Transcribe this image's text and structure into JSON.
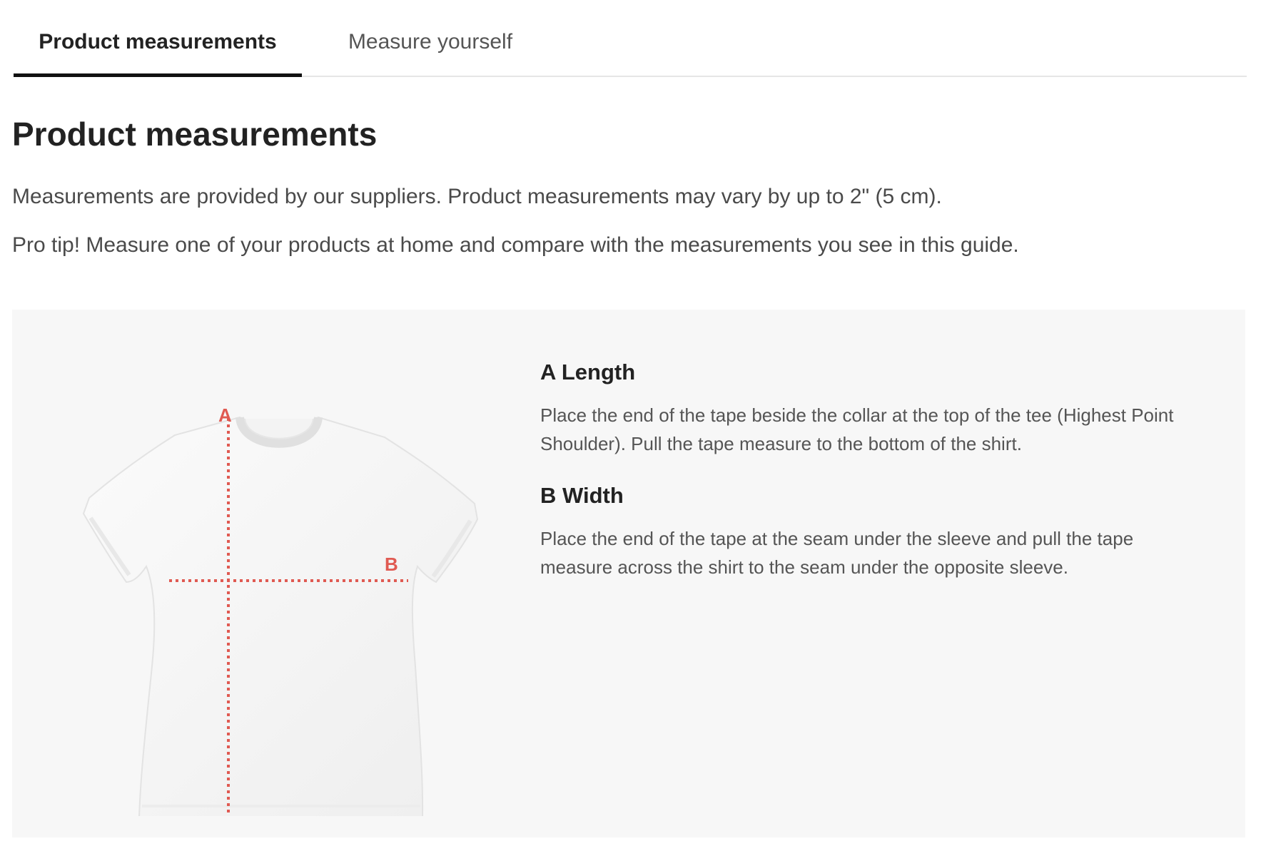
{
  "tabs": [
    {
      "label": "Product measurements",
      "active": true
    },
    {
      "label": "Measure yourself",
      "active": false
    }
  ],
  "page": {
    "title": "Product measurements",
    "intro_1": "Measurements are provided by our suppliers. Product measurements may vary by up to 2\" (5 cm).",
    "intro_2": "Pro tip! Measure one of your products at home and compare with the measurements you see in this guide."
  },
  "diagram": {
    "label_a": "A",
    "label_b": "B",
    "marker_color": "#e05a52",
    "image": "t-shirt-diagram"
  },
  "measurements": [
    {
      "title": "A Length",
      "text": "Place the end of the tape beside the collar at the top of the tee (Highest Point Shoulder). Pull the tape measure to the bottom of the shirt."
    },
    {
      "title": "B Width",
      "text": "Place the end of the tape at the seam under the sleeve and pull the tape measure across the shirt to the seam under the opposite sleeve."
    }
  ]
}
